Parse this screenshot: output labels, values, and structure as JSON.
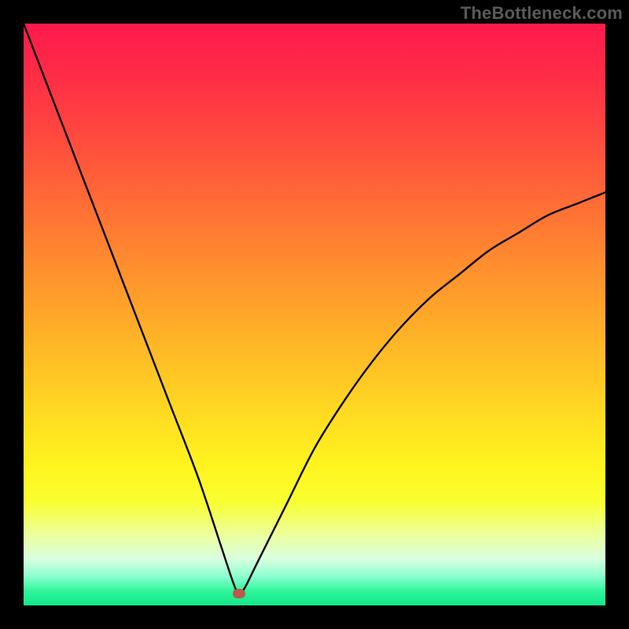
{
  "watermark": "TheBottleneck.com",
  "colors": {
    "frame": "#000000",
    "curve": "#000000",
    "marker": "#bb5a4a"
  },
  "chart_data": {
    "type": "line",
    "title": "",
    "xlabel": "",
    "ylabel": "",
    "xlim": [
      0,
      100
    ],
    "ylim": [
      0,
      100
    ],
    "grid": false,
    "notes": "V-shaped bottleneck curve over vertical rainbow gradient (red=high mismatch at top, green=optimal at bottom). Minimum near x≈37. Marker dot at minimum.",
    "series": [
      {
        "name": "bottleneck-curve",
        "x": [
          0,
          5,
          10,
          15,
          20,
          25,
          30,
          34,
          36,
          37,
          38,
          40,
          45,
          50,
          55,
          60,
          65,
          70,
          75,
          80,
          85,
          90,
          95,
          100
        ],
        "values": [
          100,
          87,
          74,
          61,
          48,
          35,
          22,
          10,
          4,
          2,
          3,
          7,
          17,
          27,
          35,
          42,
          48,
          53,
          57,
          61,
          64,
          67,
          69,
          71
        ]
      }
    ],
    "marker": {
      "x": 37,
      "y": 2
    }
  }
}
